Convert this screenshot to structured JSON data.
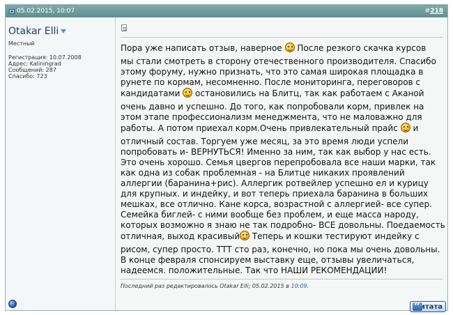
{
  "post": {
    "date": "05.02.2015, 10:07",
    "number_prefix": "#",
    "number": "218"
  },
  "user": {
    "name": "Otakar Elli",
    "title": "Местный",
    "registration": "Регистрация: 10.07.2008",
    "address": "Адрес: Kaliningrad",
    "messages": "Сообщений: 287",
    "thanks": "Спасибо: 723"
  },
  "body": {
    "l1a": "Пора уже написать отзыв, наверное",
    "l1b": "После резкого скачка курсов",
    "l2": "мы стали смотреть в сторону отечественного производителя. Спасибо",
    "l3": "этому форуму, нужно признать, что это самая широкая площадка в",
    "l4": "рунете по кормам, несомненно. После мониторинга, переговоров с",
    "l5a": "кандидатами",
    "l5b": "остановились на Блитц, так как работаем с Аканой",
    "l6": "очень давно и успешно. До того, как попробовали корм, привлек на",
    "l7": "этом этапе профессионализм менеджмента, что не маловажно для",
    "l8a": "работы. А потом приехал корм.Очень привлекательный прайс",
    "l8b": "и",
    "l9": "отличный состав. Торгуем уже месяц, за это время люди успели",
    "l10": "попробовать и- ВЕРНУТЬСЯ! Именно за ним, так как выбор у нас есть.",
    "l11": "Это очень хорошо. Семья цвергов перепробовала все наши марки, так",
    "l12": "как одна из собак проблемная - на Блитце никаких проявлений",
    "l13": "аллергии (баранина+рис). Аллергик ротвейлер успешно ел и курицу",
    "l14": "для крупных. и индейку, и вот теперь приехала баранина в больших",
    "l15": "мешках, все отлично. Кане корса, возрастной с аллергией- все супер.",
    "l16": "Семейка биглей- с ними вообще без проблем, и еще масса народу,",
    "l17": "которых возможно я знаю не так подробно- ВСЕ довольны. Поедаемость",
    "l18a": "отличная, выход красивый",
    "l18b": "Теперь и кошки тестируют индейку с",
    "l19": "рисом, супер просто. ТТТ сто раз, конечно, но пока мы очень довольны.",
    "l20": "В конце февраля спонсируем выставку еще, отзывы увеличаться,",
    "l21": "надеемся. положительные. Так что НАШИ РЕКОМЕНДАЦИИ!"
  },
  "edit": {
    "prefix": "Последний раз редактировалось Otakar Elli; 05.02.2015 в",
    "time": "10:09",
    "suffix": "."
  },
  "quote_button": {
    "label": "Цитата"
  },
  "icons": {
    "post_status": "old-post-icon",
    "user_menu": "chevron-down-icon",
    "post_doc": "document-icon",
    "smiley": "smiley-icon",
    "online_status": "offline-status-icon",
    "quote": "quote-icon"
  },
  "colors": {
    "header": "#6f9c9c",
    "username": "#22396b",
    "link": "#2a56a8"
  }
}
